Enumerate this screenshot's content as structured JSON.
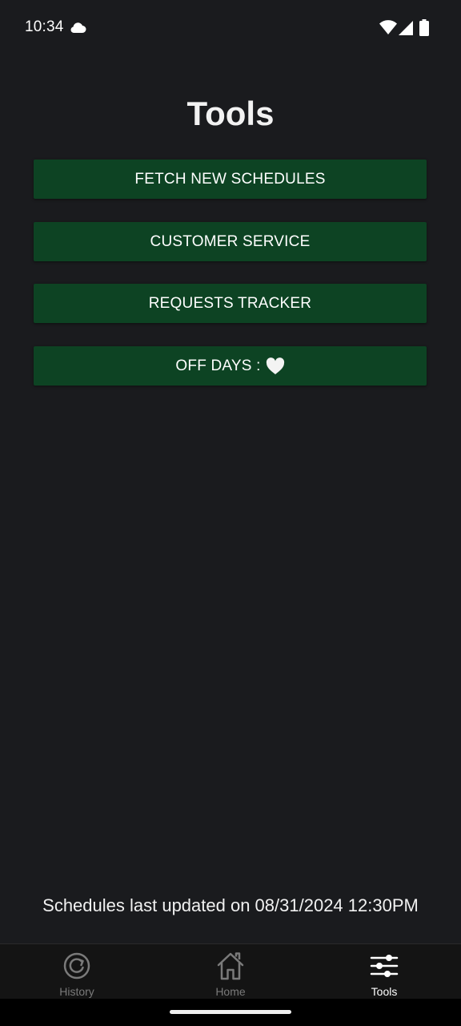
{
  "status_bar": {
    "time": "10:34",
    "icons": [
      "cloud-icon",
      "wifi-icon",
      "signal-icon",
      "battery-icon"
    ]
  },
  "page": {
    "title": "Tools"
  },
  "buttons": [
    {
      "label": "FETCH NEW SCHEDULES"
    },
    {
      "label": "CUSTOMER SERVICE"
    },
    {
      "label": "REQUESTS TRACKER"
    },
    {
      "label": "OFF DAYS :",
      "icon": "heart-icon"
    }
  ],
  "footer": {
    "last_updated": "Schedules last updated on 08/31/2024 12:30PM"
  },
  "bottom_nav": {
    "items": [
      {
        "label": "History",
        "icon": "history-icon",
        "active": false
      },
      {
        "label": "Home",
        "icon": "home-icon",
        "active": false
      },
      {
        "label": "Tools",
        "icon": "sliders-icon",
        "active": true
      }
    ]
  },
  "colors": {
    "background": "#1a1b1e",
    "button": "#0d4323",
    "nav_background": "#141414",
    "nav_inactive": "#7a7a7a",
    "nav_active": "#ffffff"
  }
}
